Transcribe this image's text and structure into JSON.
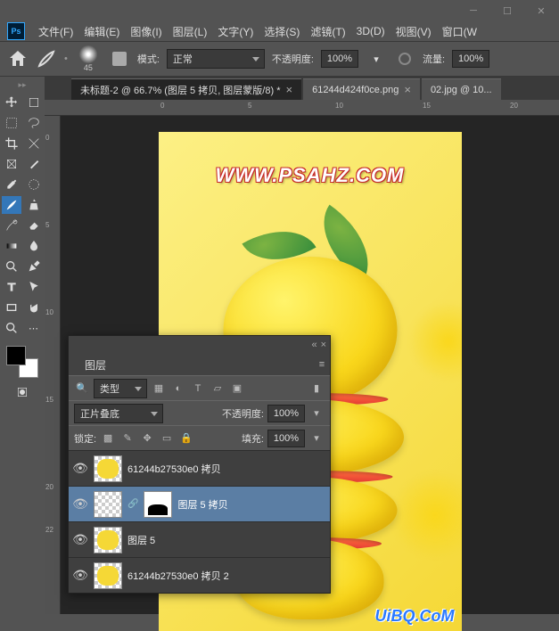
{
  "app": {
    "logo": "Ps"
  },
  "menu": {
    "file": "文件(F)",
    "edit": "编辑(E)",
    "image": "图像(I)",
    "layer": "图层(L)",
    "type": "文字(Y)",
    "select": "选择(S)",
    "filter": "滤镜(T)",
    "threeD": "3D(D)",
    "view": "视图(V)",
    "window": "窗口(W"
  },
  "options": {
    "brush_size": "45",
    "mode_label": "模式:",
    "mode_value": "正常",
    "opacity_label": "不透明度:",
    "opacity_value": "100%",
    "flow_label": "流量:",
    "flow_value": "100%"
  },
  "tabs": {
    "t1": "未标题-2 @ 66.7% (图层 5 拷贝, 图层蒙版/8) *",
    "t2": "61244d424f0ce.png",
    "t3": "02.jpg @ 10..."
  },
  "ruler_h": {
    "m1": "0",
    "m2": "5",
    "m3": "10",
    "m4": "15",
    "m5": "20"
  },
  "ruler_v": {
    "m1": "0",
    "m2": "5",
    "m3": "10",
    "m4": "15",
    "m5": "20",
    "m6": "22"
  },
  "canvas": {
    "watermark": "WWW.PSAHZ.COM",
    "watermark2": "UiBQ.CoM"
  },
  "layers_panel": {
    "title": "图层",
    "type_label": "类型",
    "blend_mode": "正片叠底",
    "opacity_label": "不透明度:",
    "opacity_value": "100%",
    "lock_label": "锁定:",
    "fill_label": "填充:",
    "fill_value": "100%",
    "layers": {
      "l1": "61244b27530e0 拷贝",
      "l2": "图层 5 拷贝",
      "l3": "图层 5",
      "l4": "61244b27530e0 拷贝 2"
    }
  }
}
